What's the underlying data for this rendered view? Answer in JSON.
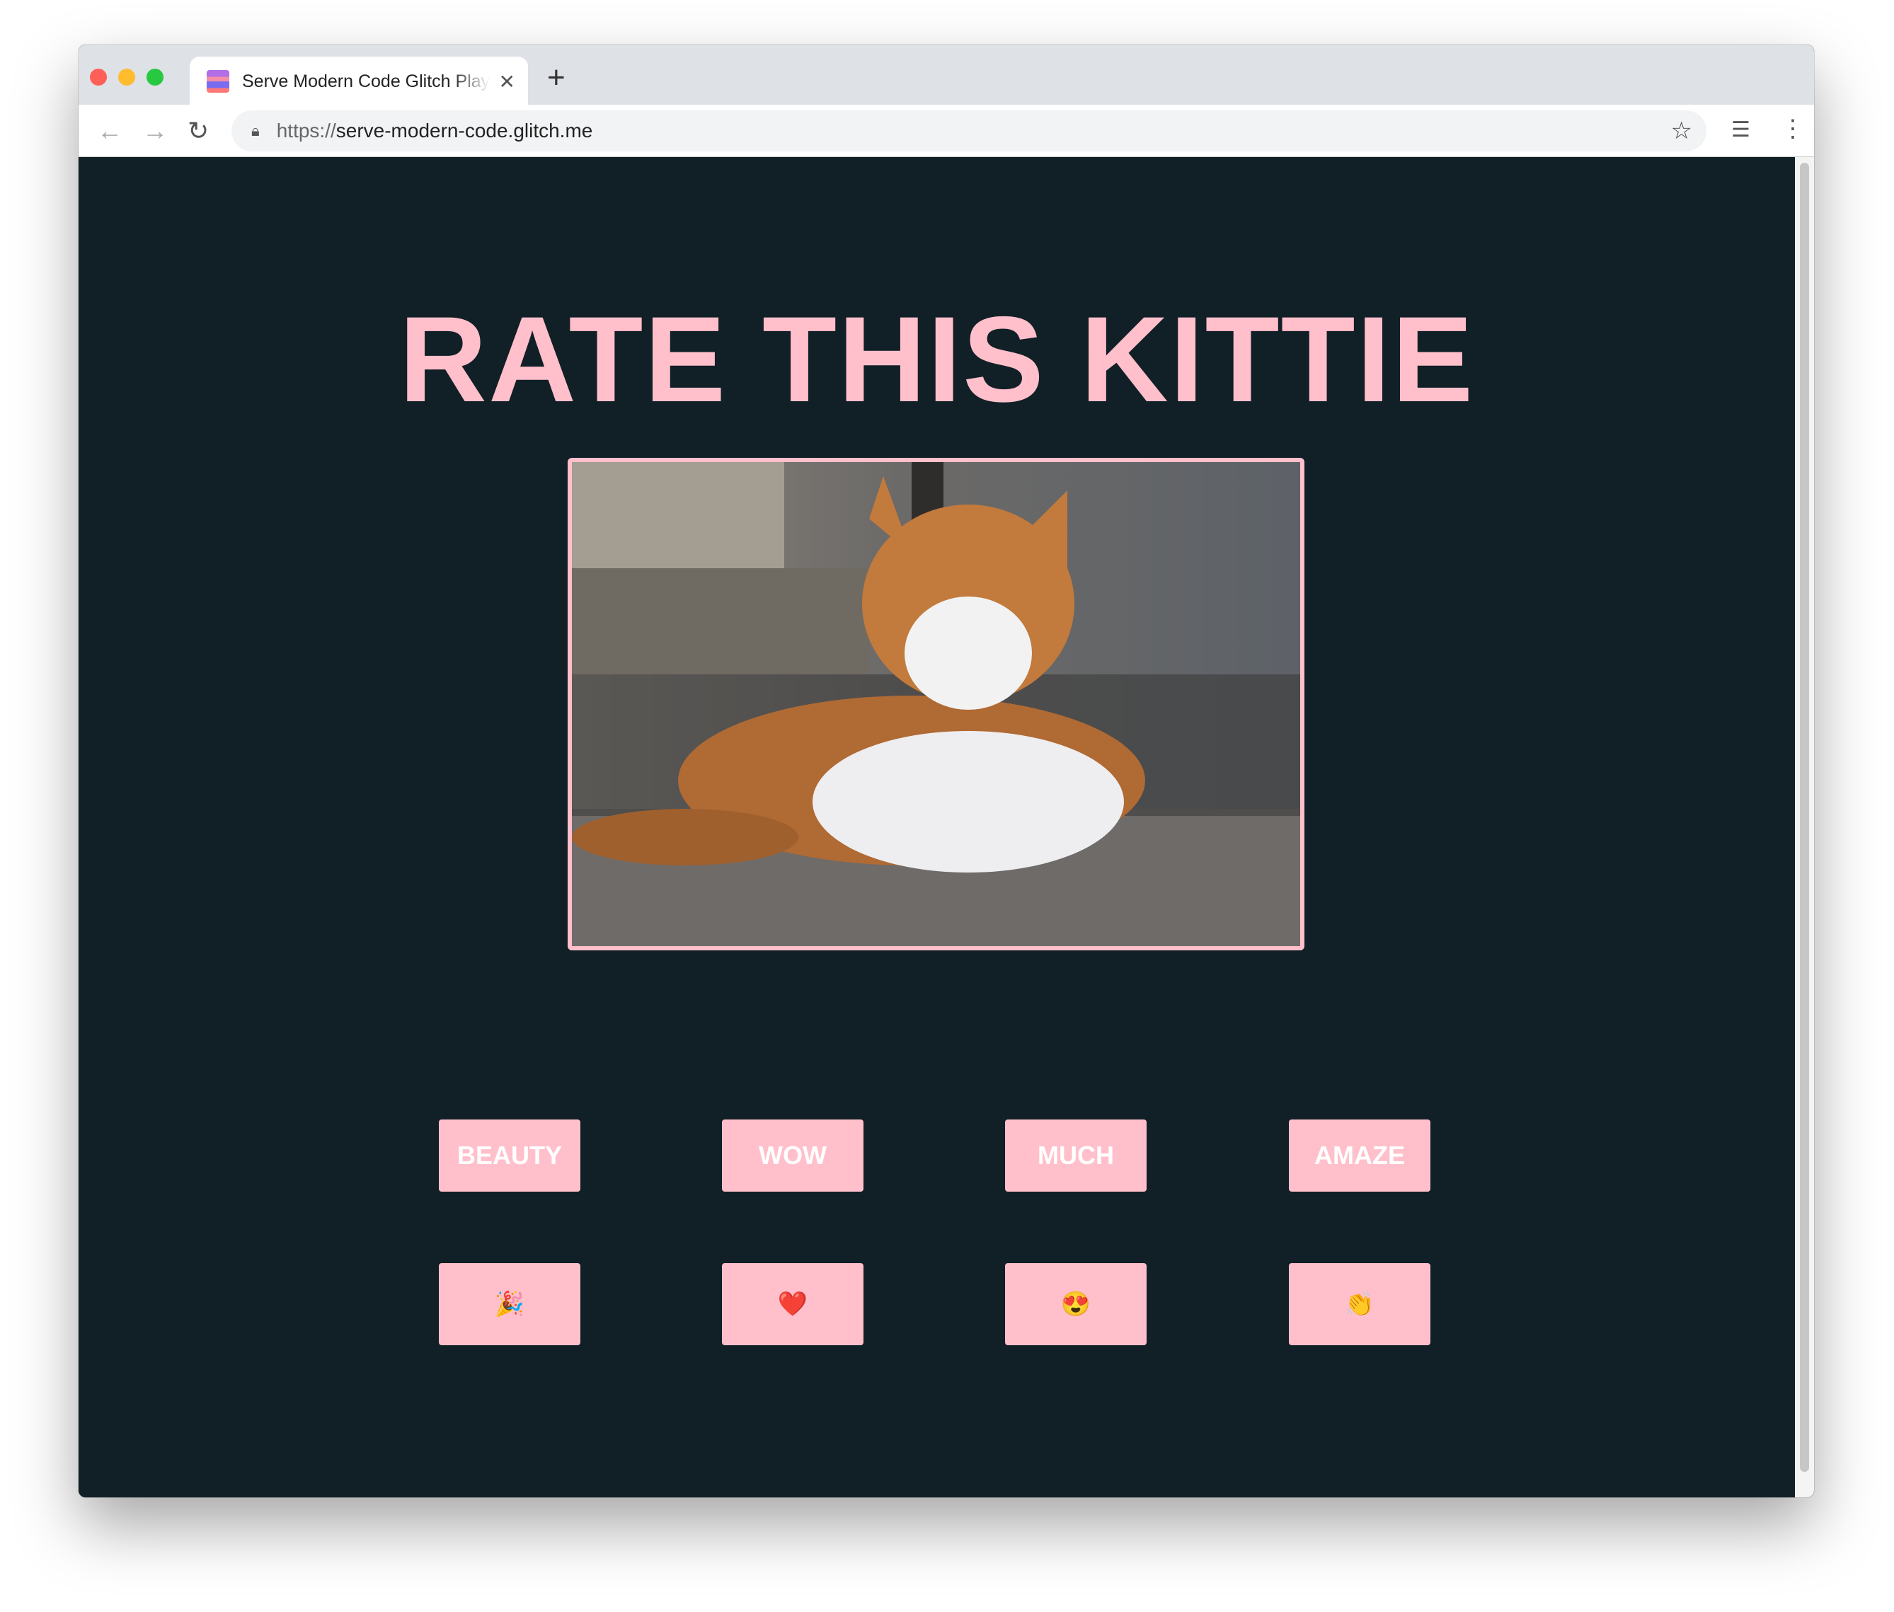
{
  "browser": {
    "tab_title": "Serve Modern Code Glitch Playground",
    "url_scheme": "https://",
    "url_host": "serve-modern-code.glitch.me",
    "traffic_lights": [
      "#fe5f57",
      "#febc2e",
      "#28c840"
    ]
  },
  "page": {
    "title": "RATE THIS KITTIE",
    "image_alt": "orange and white cat lying on floor",
    "accent_color": "#ffc0cb",
    "background_color": "#111f26",
    "word_buttons": [
      "BEAUTY",
      "WOW",
      "MUCH",
      "AMAZE"
    ],
    "emoji_buttons": [
      "🎉",
      "❤️",
      "😍",
      "👏"
    ]
  }
}
